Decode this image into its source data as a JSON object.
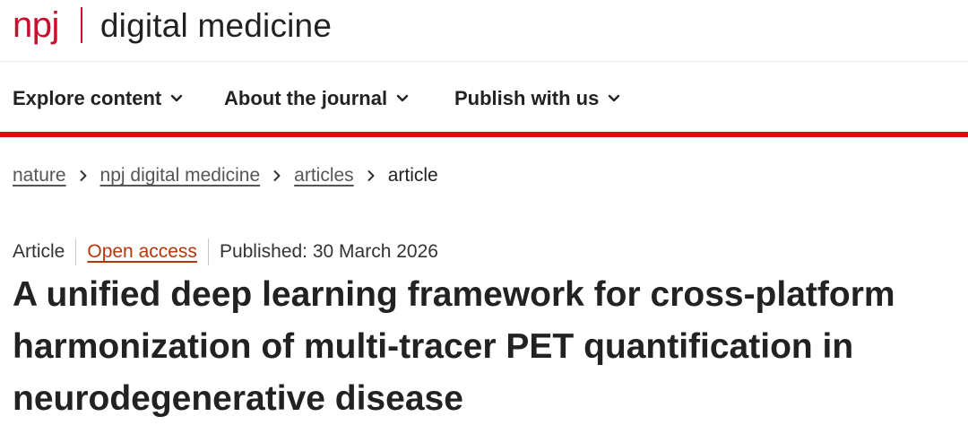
{
  "header": {
    "brand_npj": "npj",
    "brand_name": "digital medicine",
    "brand_color": "#c8102e"
  },
  "nav": {
    "items": [
      {
        "label": "Explore content",
        "icon": "chevron-down-icon"
      },
      {
        "label": "About the journal",
        "icon": "chevron-down-icon"
      },
      {
        "label": "Publish with us",
        "icon": "chevron-down-icon"
      }
    ],
    "accent_color": "#e10b0b"
  },
  "breadcrumb": {
    "items": [
      "nature",
      "npj digital medicine",
      "articles"
    ],
    "current": "article",
    "separator_icon": "chevron-right-icon"
  },
  "article": {
    "type": "Article",
    "access": "Open access",
    "published": "Published: 30 March 2026",
    "title": "A unified deep learning framework for cross-platform harmonization of multi-tracer PET quantification in neurodegenerative disease"
  }
}
